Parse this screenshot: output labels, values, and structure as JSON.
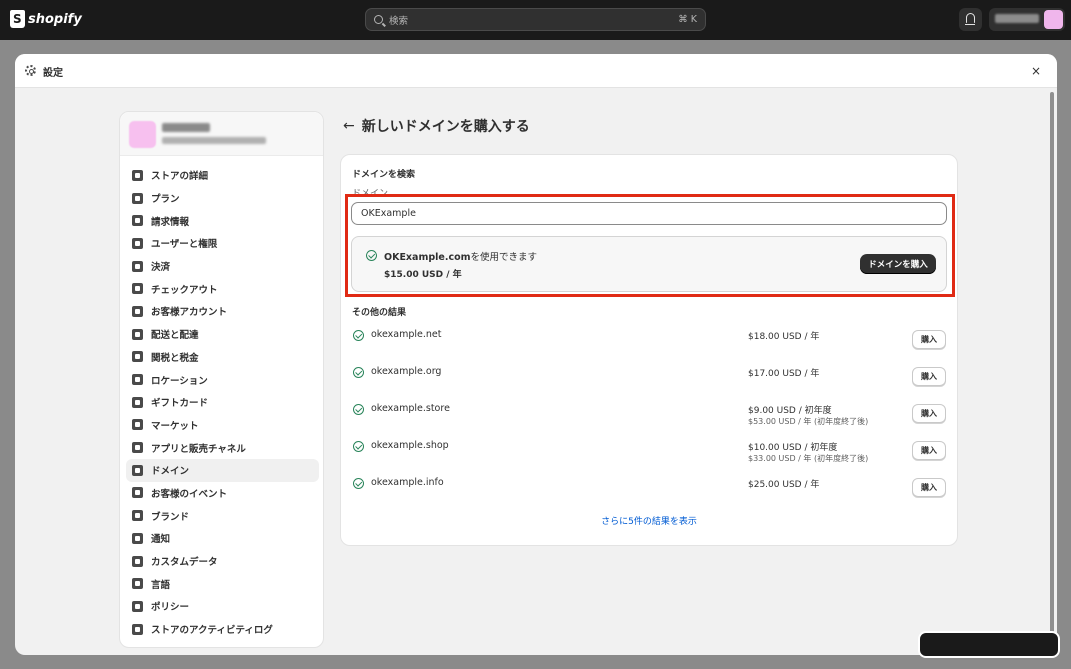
{
  "topbar": {
    "logo_text": "shopify",
    "search_placeholder": "検索",
    "search_shortcut": "⌘ K",
    "icons": [
      "search-icon",
      "bell-icon",
      "avatar"
    ]
  },
  "modal": {
    "title": "設定",
    "close_label": "×"
  },
  "sidebar": {
    "items": [
      {
        "label": "ストアの詳細",
        "icon": "store-icon"
      },
      {
        "label": "プラン",
        "icon": "plan-icon"
      },
      {
        "label": "請求情報",
        "icon": "billing-icon"
      },
      {
        "label": "ユーザーと権限",
        "icon": "users-icon"
      },
      {
        "label": "決済",
        "icon": "payments-icon"
      },
      {
        "label": "チェックアウト",
        "icon": "cart-icon"
      },
      {
        "label": "お客様アカウント",
        "icon": "customer-account-icon"
      },
      {
        "label": "配送と配達",
        "icon": "truck-icon"
      },
      {
        "label": "関税と税金",
        "icon": "tax-icon"
      },
      {
        "label": "ロケーション",
        "icon": "location-icon"
      },
      {
        "label": "ギフトカード",
        "icon": "gift-card-icon"
      },
      {
        "label": "マーケット",
        "icon": "market-icon"
      },
      {
        "label": "アプリと販売チャネル",
        "icon": "apps-icon"
      },
      {
        "label": "ドメイン",
        "icon": "globe-icon",
        "active": true
      },
      {
        "label": "お客様のイベント",
        "icon": "events-icon"
      },
      {
        "label": "ブランド",
        "icon": "brand-icon"
      },
      {
        "label": "通知",
        "icon": "notification-icon"
      },
      {
        "label": "カスタムデータ",
        "icon": "custom-data-icon"
      },
      {
        "label": "言語",
        "icon": "language-icon"
      },
      {
        "label": "ポリシー",
        "icon": "policy-icon"
      },
      {
        "label": "ストアのアクティビティログ",
        "icon": "activity-log-icon"
      }
    ]
  },
  "main": {
    "back_label": "←",
    "title": "新しいドメインを購入する",
    "search_section_title": "ドメインを検索",
    "domain_field_label": "ドメイン",
    "domain_value": "OKExample",
    "available": {
      "domain": "OKExample.com",
      "suffix": "を使用できます",
      "price": "$15.00 USD / 年",
      "buy_label": "ドメインを購入"
    },
    "other_results_title": "その他の結果",
    "results": [
      {
        "domain": "okexample.net",
        "price": "$18.00 USD / 年",
        "renewal": "",
        "buy_label": "購入"
      },
      {
        "domain": "okexample.org",
        "price": "$17.00 USD / 年",
        "renewal": "",
        "buy_label": "購入"
      },
      {
        "domain": "okexample.store",
        "price": "$9.00 USD / 初年度",
        "renewal": "$53.00 USD / 年 (初年度終了後)",
        "buy_label": "購入"
      },
      {
        "domain": "okexample.shop",
        "price": "$10.00 USD / 初年度",
        "renewal": "$33.00 USD / 年 (初年度終了後)",
        "buy_label": "購入"
      },
      {
        "domain": "okexample.info",
        "price": "$25.00 USD / 年",
        "renewal": "",
        "buy_label": "購入"
      }
    ],
    "show_more_label": "さらに5件の結果を表示"
  },
  "colors": {
    "topbar": "#1a1a1a",
    "highlight": "#e02a14",
    "success": "#29845a",
    "link": "#005bd3",
    "primary_button": "#303030"
  }
}
